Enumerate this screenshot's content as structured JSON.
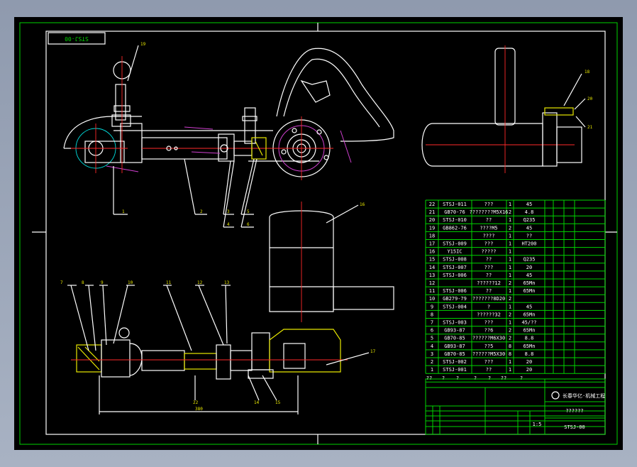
{
  "drawing": {
    "stamp_code": "STSJ-00",
    "title_code": "STSJ-00",
    "title_name": "??????",
    "school": "长春华亿·机械工程",
    "scale": "1:5",
    "dimension_length": "380"
  },
  "parts_table": [
    {
      "no": "22",
      "code": "STSJ-011",
      "name": "???",
      "qty": "1",
      "mat": "45"
    },
    {
      "no": "21",
      "code": "GB70-76",
      "name": "????????M5X16",
      "qty": "2",
      "mat": "4.8"
    },
    {
      "no": "20",
      "code": "STSJ-010",
      "name": "??",
      "qty": "1",
      "mat": "Q235"
    },
    {
      "no": "19",
      "code": "GB862-76",
      "name": "????M5",
      "qty": "2",
      "mat": "45"
    },
    {
      "no": "18",
      "code": "",
      "name": "????",
      "qty": "1",
      "mat": "??"
    },
    {
      "no": "17",
      "code": "STSJ-009",
      "name": "???",
      "qty": "1",
      "mat": "HT200"
    },
    {
      "no": "16",
      "code": "Y15IC",
      "name": "?????",
      "qty": "1",
      "mat": ""
    },
    {
      "no": "15",
      "code": "STSJ-008",
      "name": "??",
      "qty": "1",
      "mat": "Q235"
    },
    {
      "no": "14",
      "code": "STSJ-007",
      "name": "???",
      "qty": "1",
      "mat": "20"
    },
    {
      "no": "13",
      "code": "STSJ-006",
      "name": "??",
      "qty": "1",
      "mat": "45"
    },
    {
      "no": "12",
      "code": "",
      "name": "??????12",
      "qty": "2",
      "mat": "65Mn"
    },
    {
      "no": "11",
      "code": "STSJ-006",
      "name": "??",
      "qty": "1",
      "mat": "65Mn"
    },
    {
      "no": "10",
      "code": "GB279-79",
      "name": "???????8D20",
      "qty": "2",
      "mat": ""
    },
    {
      "no": "9",
      "code": "STSJ-004",
      "name": "?",
      "qty": "1",
      "mat": "45"
    },
    {
      "no": "8",
      "code": "",
      "name": "??????32",
      "qty": "2",
      "mat": "65Mn"
    },
    {
      "no": "7",
      "code": "STSJ-003",
      "name": "???",
      "qty": "1",
      "mat": "45/??"
    },
    {
      "no": "6",
      "code": "GB93-87",
      "name": "??6",
      "qty": "2",
      "mat": "65Mn"
    },
    {
      "no": "5",
      "code": "GB70-85",
      "name": "??????M6X30",
      "qty": "2",
      "mat": "8.8"
    },
    {
      "no": "4",
      "code": "GB93-87",
      "name": "??5",
      "qty": "8",
      "mat": "65Mn"
    },
    {
      "no": "3",
      "code": "GB70-85",
      "name": "??????M5X30",
      "qty": "8",
      "mat": "8.8"
    },
    {
      "no": "2",
      "code": "STSJ-002",
      "name": "???",
      "qty": "1",
      "mat": "20"
    },
    {
      "no": "1",
      "code": "STSJ-001",
      "name": "??",
      "qty": "1",
      "mat": "20"
    }
  ],
  "header_row": [
    "??",
    "?",
    "?",
    "?",
    "?",
    "??",
    "?"
  ],
  "callouts_top": [
    "1",
    "2",
    "3",
    "4",
    "5",
    "6",
    "19",
    "18",
    "20",
    "21"
  ],
  "callouts_bottom": [
    "7",
    "8",
    "9",
    "10",
    "11",
    "12",
    "13",
    "14",
    "15",
    "16",
    "17",
    "22"
  ],
  "colors": {
    "frame": "#00d400",
    "lines": "#ffffff",
    "centerline": "#ff2a2a",
    "hidden": "#d040d0",
    "dim": "#e8e800",
    "background": "#000000"
  }
}
